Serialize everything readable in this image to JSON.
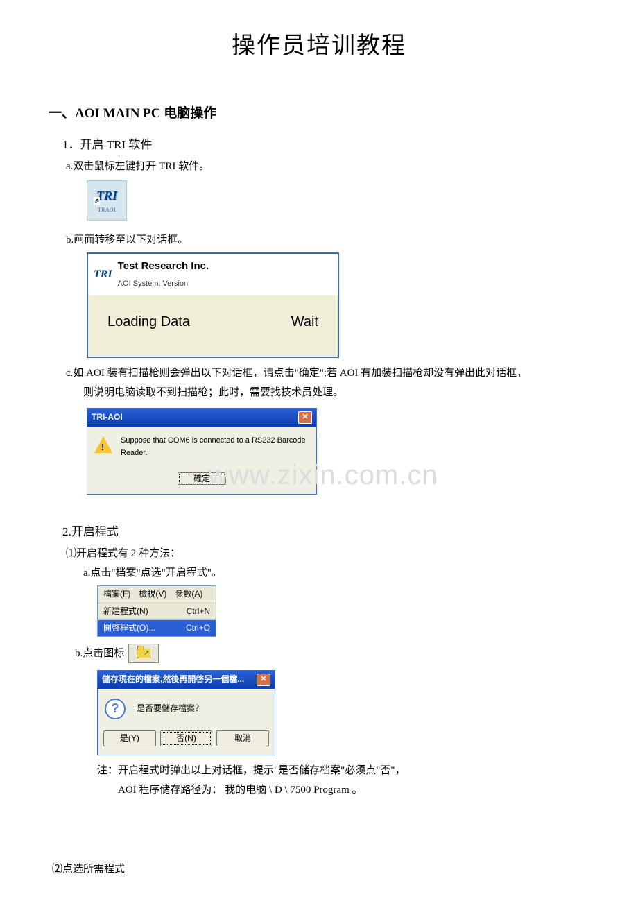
{
  "title": "操作员培训教程",
  "section1": {
    "heading": "一、AOI MAIN PC  电脑操作",
    "sub1": "1．开启 TRI 软件",
    "step_a": "a.双击鼠标左键打开 TRI 软件。",
    "tri_icon": {
      "logo": "TRI",
      "label": "TRAOI"
    },
    "step_b": "b.画面转移至以下对话框。",
    "loading": {
      "brand": "TRI",
      "title": "Test Research Inc.",
      "subtitle": "AOI System, Version",
      "status": "Loading Data",
      "wait": "Wait"
    },
    "step_c_1": "c.如 AOI  装有扫描枪则会弹出以下对话框，请点击\"确定\";若 AOI 有加装扫描枪却没有弹出此对话框，",
    "step_c_2": "则说明电脑读取不到扫描枪；此时，需要找技术员处理。",
    "triaoi": {
      "title": "TRI-AOI",
      "close": "✕",
      "msg": "Suppose that COM6 is connected to a RS232 Barcode Reader.",
      "ok": "確定"
    }
  },
  "watermark": "www.zixin.com.cn",
  "section2": {
    "heading": "2.开启程式",
    "sub1": "⑴开启程式有 2 种方法：",
    "step_a": "a.点击\"档案\"点选\"开启程式\"。",
    "menu": {
      "bar1": "檔案(F)",
      "bar2": "檢視(V)",
      "bar3": "參數(A)",
      "item1_l": "新建程式(N)",
      "item1_r": "Ctrl+N",
      "item2_l": "開啓程式(O)...",
      "item2_r": "Ctrl+O"
    },
    "step_b": "b.点击图标",
    "save_dialog": {
      "title": "儲存現在的檔案,然後再開啓另一個檔...",
      "close": "✕",
      "msg": "是否要儲存檔案？",
      "yes": "是(Y)",
      "no": "否(N)",
      "cancel": "取消"
    },
    "note1": "注：开启程式时弹出以上对话框，提示\"是否储存档案\"必须点\"否\"，",
    "note2": "AOI  程序储存路径为：  我的电脑  \\ D \\ 7500 Program 。",
    "sub2": "⑵点选所需程式"
  }
}
